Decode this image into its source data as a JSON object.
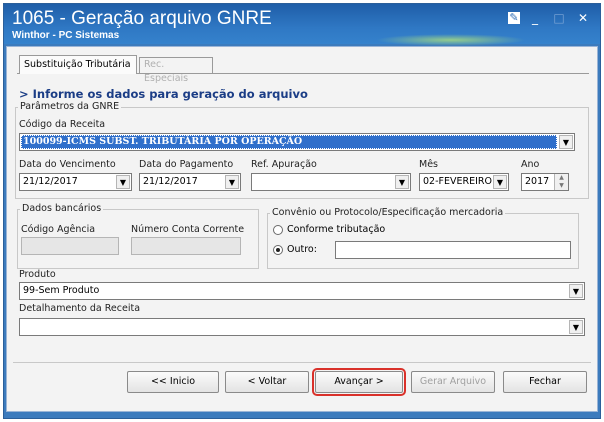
{
  "window": {
    "title": "1065 - Geração arquivo GNRE",
    "subtitle": "Winthor - PC Sistemas",
    "controls": {
      "edit": "✎",
      "minimize": "_",
      "maximize": "□",
      "close": "✕"
    }
  },
  "tabs": [
    {
      "label": "Substituição Tributária",
      "active": true
    },
    {
      "label": "Rec. Especiais",
      "active": false
    }
  ],
  "heading": "> Informe os dados para geração do arquivo",
  "parametros": {
    "legend": "Parâmetros da GNRE",
    "codigo_receita_label": "Código da Receita",
    "codigo_receita_value": "100099-ICMS SUBST. TRIBUTÁRIA POR OPERAÇÃO",
    "data_vencimento_label": "Data do Vencimento",
    "data_vencimento_value": "21/12/2017",
    "data_pagamento_label": "Data do Pagamento",
    "data_pagamento_value": "21/12/2017",
    "ref_apuracao_label": "Ref. Apuração",
    "ref_apuracao_value": "",
    "mes_label": "Mês",
    "mes_value": "02-FEVEREIRO",
    "ano_label": "Ano",
    "ano_value": "2017"
  },
  "dados_bancarios": {
    "legend": "Dados bancários",
    "codigo_agencia_label": "Código Agência",
    "conta_corrente_label": "Número Conta Corrente"
  },
  "convenio": {
    "legend": "Convênio ou Protocolo/Especificação mercadoria",
    "option_conforme": "Conforme tributação",
    "option_outro": "Outro:",
    "selected": "Outro:"
  },
  "produto": {
    "label": "Produto",
    "value": "99-Sem Produto"
  },
  "detalhamento": {
    "label": "Detalhamento da Receita",
    "value": ""
  },
  "buttons": {
    "inicio": "<< Inicio",
    "voltar": "< Voltar",
    "avancar": "Avançar >",
    "gerar": "Gerar Arquivo",
    "fechar": "Fechar"
  }
}
